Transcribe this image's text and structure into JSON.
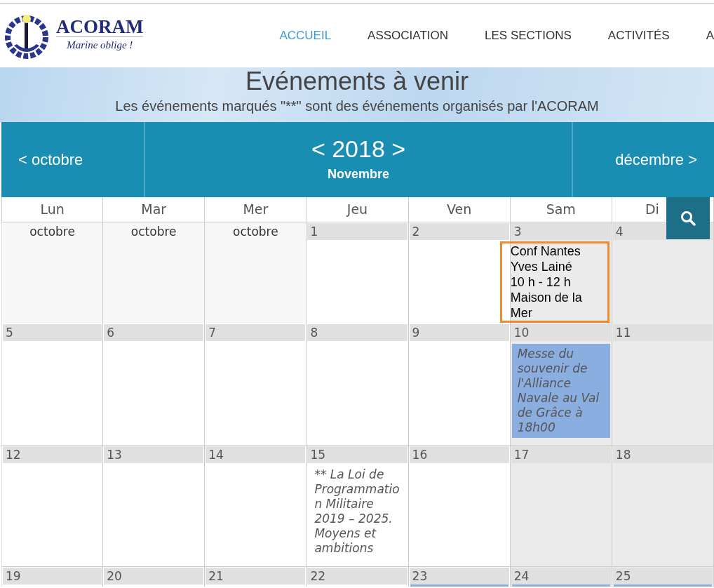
{
  "site": {
    "name": "ACORAM",
    "tagline": "Marine oblige !"
  },
  "nav": [
    {
      "label": "ACCUEIL",
      "selected": true
    },
    {
      "label": "ASSOCIATION",
      "selected": false
    },
    {
      "label": "LES SECTIONS",
      "selected": false
    },
    {
      "label": "ACTIVITÉS",
      "selected": false
    },
    {
      "label": "A",
      "selected": false
    }
  ],
  "banner": {
    "title": "Evénements à venir",
    "subtitle": "Les événements marqués \"**\" sont des événements organisés par l'ACORAM"
  },
  "calendar": {
    "prev": "< octobre",
    "year": "< 2018 >",
    "month": "Novembre",
    "next": "décembre >",
    "weekdays": [
      "Lun",
      "Mar",
      "Mer",
      "Jeu",
      "Ven",
      "Sam",
      "Di"
    ],
    "weeks": [
      [
        {
          "kind": "other",
          "label": "octobre"
        },
        {
          "kind": "other",
          "label": "octobre"
        },
        {
          "kind": "other",
          "label": "octobre"
        },
        {
          "kind": "day",
          "label": "1",
          "weekend": false
        },
        {
          "kind": "day",
          "label": "2",
          "weekend": false
        },
        {
          "kind": "day",
          "label": "3",
          "weekend": true,
          "events": [
            {
              "kind": "outlined",
              "text": "Conf Nantes\nYves Lainé\n10 h - 12 h\nMaison de la\nMer"
            }
          ]
        },
        {
          "kind": "day",
          "label": "4",
          "weekend": true
        }
      ],
      [
        {
          "kind": "day",
          "label": "5",
          "weekend": false
        },
        {
          "kind": "day",
          "label": "6",
          "weekend": false
        },
        {
          "kind": "day",
          "label": "7",
          "weekend": false
        },
        {
          "kind": "day",
          "label": "8",
          "weekend": false
        },
        {
          "kind": "day",
          "label": "9",
          "weekend": false
        },
        {
          "kind": "day",
          "label": "10",
          "weekend": true,
          "events": [
            {
              "kind": "filled",
              "text": "Messe du\nsouvenir de\nl'Alliance\nNavale au Val\nde Grâce à\n18h00"
            }
          ]
        },
        {
          "kind": "day",
          "label": "11",
          "weekend": true
        }
      ],
      [
        {
          "kind": "day",
          "label": "12",
          "weekend": false
        },
        {
          "kind": "day",
          "label": "13",
          "weekend": false
        },
        {
          "kind": "day",
          "label": "14",
          "weekend": false
        },
        {
          "kind": "day",
          "label": "15",
          "weekend": false,
          "events": [
            {
              "kind": "plain",
              "text": "** La Loi de\nProgrammatio\nn Militaire\n2019 – 2025.\nMoyens et\nambitions"
            }
          ]
        },
        {
          "kind": "day",
          "label": "16",
          "weekend": false
        },
        {
          "kind": "day",
          "label": "17",
          "weekend": true
        },
        {
          "kind": "day",
          "label": "18",
          "weekend": true
        }
      ],
      [
        {
          "kind": "day",
          "label": "19",
          "weekend": false
        },
        {
          "kind": "day",
          "label": "20",
          "weekend": false
        },
        {
          "kind": "day",
          "label": "21",
          "weekend": false
        },
        {
          "kind": "day",
          "label": "22",
          "weekend": false
        },
        {
          "kind": "day",
          "label": "23",
          "weekend": false,
          "event_below": true
        },
        {
          "kind": "day",
          "label": "24",
          "weekend": true,
          "event_below": true
        },
        {
          "kind": "day",
          "label": "25",
          "weekend": true,
          "event_below": true
        }
      ]
    ]
  }
}
